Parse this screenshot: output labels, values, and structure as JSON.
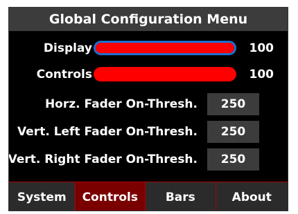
{
  "title": "Global Configuration Menu",
  "sliders": [
    {
      "label": "Display",
      "value": "100",
      "level": 1.0,
      "focused": true
    },
    {
      "label": "Controls",
      "value": "100",
      "level": 1.0,
      "focused": false
    }
  ],
  "thresholds": [
    {
      "label": "Horz. Fader On-Thresh.",
      "value": "250"
    },
    {
      "label": "Vert. Left Fader On-Thresh.",
      "value": "250"
    },
    {
      "label": "Vert. Right Fader On-Thresh.",
      "value": "250"
    }
  ],
  "tabs": [
    {
      "label": "System",
      "active": false
    },
    {
      "label": "Controls",
      "active": true
    },
    {
      "label": "Bars",
      "active": false
    },
    {
      "label": "About",
      "active": false
    }
  ],
  "colors": {
    "background": "#000000",
    "title_bar": "#3c3c3c",
    "slider_fill": "#ff0000",
    "focus_ring": "#1f6fd1",
    "active_tab": "#7a0000",
    "tab_divider": "#b00000"
  }
}
